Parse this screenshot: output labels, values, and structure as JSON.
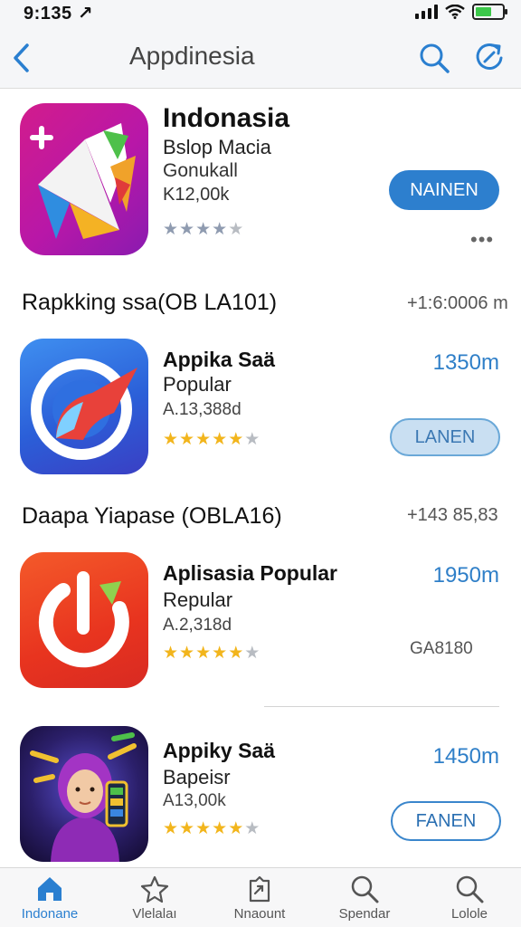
{
  "status_bar": {
    "time": "9:135 ↗"
  },
  "nav": {
    "title": "Appdinesia"
  },
  "featured": {
    "title": "Indonasia",
    "subtitle": "Bslop Macia",
    "category": "Gonukall",
    "price": "K12,00k",
    "button_label": "NAINEN",
    "rating": 4,
    "more_label": "•••"
  },
  "sections": [
    {
      "title": "Rapkking ssa(OB LA101)",
      "right": "+1:6:0006 m"
    },
    {
      "title": "Daapa Yiapase (OBLA16)",
      "right": "+143 85,83"
    }
  ],
  "apps": [
    {
      "name": "Appika Saä",
      "category": "Popular",
      "version": "A.13,388d",
      "size": "1350m",
      "button_label": "LANEN",
      "rating": 4.5
    },
    {
      "name": "Aplisasia Popular",
      "category": "Repular",
      "version": "A.2,318d",
      "size": "1950m",
      "status_label": "GA8180",
      "rating": 4.5
    },
    {
      "name": "Appiky Saä",
      "category": "Bapeisr",
      "version": "A13,00k",
      "size": "1450m",
      "button_label": "FANEN",
      "rating": 4.5
    }
  ],
  "tabs": [
    {
      "label": "Indonane"
    },
    {
      "label": "Vlelalaı"
    },
    {
      "label": "Nnaount"
    },
    {
      "label": "Spendar"
    },
    {
      "label": "Lolole"
    }
  ],
  "colors": {
    "accent": "#2d7fce",
    "star": "#f2b51c",
    "size_text": "#2f7fc8"
  }
}
